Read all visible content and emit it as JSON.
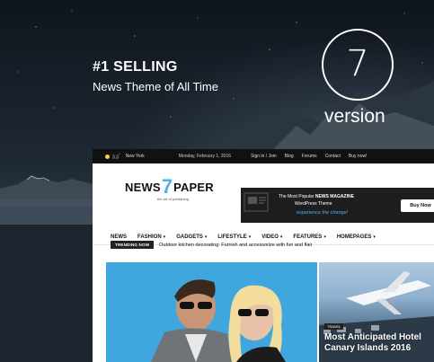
{
  "hero": {
    "title": "#1 SELLING",
    "subtitle": "News Theme of All Time",
    "version_number": "7",
    "version_label": "version"
  },
  "site": {
    "topbar": {
      "temperature": "3.3",
      "temperature_unit": "°",
      "city": "New York",
      "date": "Monday, February 1, 2016",
      "links": [
        "Sign in / Join",
        "Blog",
        "Forums",
        "Contact",
        "Buy now!"
      ]
    },
    "logo": {
      "left": "NEWS",
      "number": "7",
      "right": "PAPER",
      "tagline": "the art of publishing"
    },
    "ad": {
      "line1_prefix": "The Most Popular",
      "line1_bold": "NEWS MAGAZINE",
      "line2": "WordPress Theme",
      "line3": "experience the change!",
      "button": "Buy Now"
    },
    "nav": [
      {
        "label": "NEWS",
        "dropdown": false,
        "active": true
      },
      {
        "label": "FASHION",
        "dropdown": true,
        "active": false
      },
      {
        "label": "GADGETS",
        "dropdown": true,
        "active": false
      },
      {
        "label": "LIFESTYLE",
        "dropdown": true,
        "active": false
      },
      {
        "label": "VIDEO",
        "dropdown": true,
        "active": false
      },
      {
        "label": "FEATURES",
        "dropdown": true,
        "active": false
      },
      {
        "label": "HOMEPAGES",
        "dropdown": true,
        "active": false
      }
    ],
    "trending": {
      "badge": "TRENDING NOW",
      "headline": "Outdoor kitchen decorating: Furnish and accessorize with fun and flair"
    },
    "tiles": [
      {
        "category": "",
        "title": ""
      },
      {
        "category": "TRAVEL",
        "title": "Most Anticipated Hotel Canary Islands 2016"
      }
    ]
  },
  "colors": {
    "accent": "#4db2ec",
    "topbar_bg": "#111111",
    "ad_bg": "#1e1e1e"
  }
}
